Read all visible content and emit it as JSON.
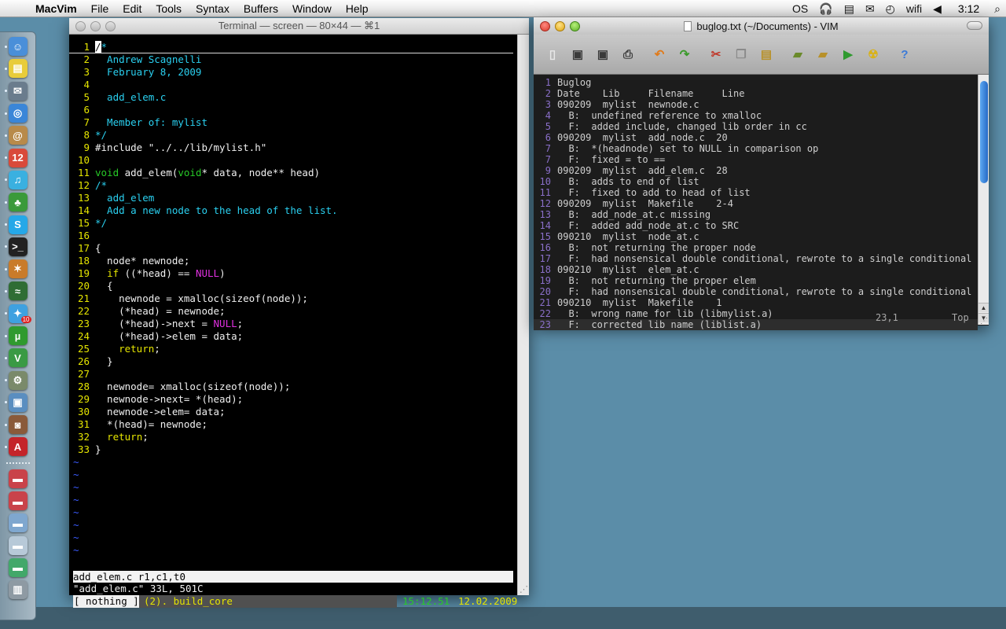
{
  "menubar": {
    "apple": "",
    "app_name": "MacVim",
    "items": [
      "File",
      "Edit",
      "Tools",
      "Syntax",
      "Buffers",
      "Window",
      "Help"
    ],
    "extras": [
      "OS",
      "🎧",
      "▤",
      "✉",
      "◴",
      "wifi",
      "◀"
    ],
    "clock": "3:12",
    "search_icon": "⌕"
  },
  "dock": {
    "items": [
      {
        "name": "finder",
        "glyph": "☺",
        "color": "#4a8fd9",
        "running": true
      },
      {
        "name": "stickies",
        "glyph": "▤",
        "color": "#e8cc3a",
        "running": true
      },
      {
        "name": "mail",
        "glyph": "✉",
        "color": "#6a7c8d",
        "running": true
      },
      {
        "name": "safari",
        "glyph": "◎",
        "color": "#3a86d8",
        "running": true
      },
      {
        "name": "address-book",
        "glyph": "@",
        "color": "#b88a4a",
        "running": true
      },
      {
        "name": "ical",
        "glyph": "12",
        "color": "#d94a3a",
        "running": true
      },
      {
        "name": "itunes",
        "glyph": "♫",
        "color": "#3ab0e0",
        "running": true
      },
      {
        "name": "adium",
        "glyph": "♣",
        "color": "#3a9a3a",
        "running": true
      },
      {
        "name": "skype",
        "glyph": "S",
        "color": "#25a8e8",
        "running": true
      },
      {
        "name": "terminal",
        "glyph": ">_",
        "color": "#222222",
        "running": true
      },
      {
        "name": "growl",
        "glyph": "✶",
        "color": "#c97b2a",
        "running": true
      },
      {
        "name": "activity-monitor",
        "glyph": "≈",
        "color": "#2f6d34",
        "running": true
      },
      {
        "name": "twitter",
        "glyph": "✦",
        "color": "#3fa1e0",
        "running": true,
        "badge": "10"
      },
      {
        "name": "utorrent",
        "glyph": "µ",
        "color": "#2f9a2f",
        "running": true
      },
      {
        "name": "macvim",
        "glyph": "V",
        "color": "#3a9a44",
        "running": true
      },
      {
        "name": "system-prefs",
        "glyph": "⚙",
        "color": "#7a8a6a",
        "running": true
      },
      {
        "name": "preview",
        "glyph": "▣",
        "color": "#5a8ec0",
        "running": true
      },
      {
        "name": "photo-booth",
        "glyph": "◙",
        "color": "#8a5a3a",
        "running": true
      },
      {
        "name": "adobe",
        "glyph": "A",
        "color": "#c4242a",
        "running": true
      }
    ],
    "stacks": [
      {
        "name": "downloads-folder",
        "glyph": "▬",
        "color": "#c9434a"
      },
      {
        "name": "applications-folder",
        "glyph": "▬",
        "color": "#c9434a"
      },
      {
        "name": "documents-folder",
        "glyph": "▬",
        "color": "#7fa7cf"
      },
      {
        "name": "pictures-folder",
        "glyph": "▬",
        "color": "#b7c9d8"
      },
      {
        "name": "music-folder",
        "glyph": "▬",
        "color": "#42a86a"
      },
      {
        "name": "trash",
        "glyph": "▥",
        "color": "#8e9aa3"
      }
    ]
  },
  "terminal": {
    "title": "Terminal — screen — 80×44 — ⌘1",
    "lines": [
      {
        "n": "1",
        "parts": [
          [
            "cursor",
            "/"
          ],
          [
            "c-cm",
            "*"
          ]
        ]
      },
      {
        "n": "2",
        "parts": [
          [
            "c-cm",
            "  Andrew Scagnelli"
          ]
        ]
      },
      {
        "n": "3",
        "parts": [
          [
            "c-cm",
            "  February 8, 2009"
          ]
        ]
      },
      {
        "n": "4",
        "parts": [
          [
            "",
            ""
          ]
        ]
      },
      {
        "n": "5",
        "parts": [
          [
            "c-cm",
            "  add_elem.c"
          ]
        ]
      },
      {
        "n": "6",
        "parts": [
          [
            "",
            ""
          ]
        ]
      },
      {
        "n": "7",
        "parts": [
          [
            "c-cm",
            "  Member of: mylist"
          ]
        ]
      },
      {
        "n": "8",
        "parts": [
          [
            "c-cm",
            "*/"
          ]
        ]
      },
      {
        "n": "9",
        "parts": [
          [
            "c-pp",
            "#include \"../../lib/mylist.h\""
          ]
        ]
      },
      {
        "n": "10",
        "parts": [
          [
            "",
            ""
          ]
        ]
      },
      {
        "n": "11",
        "parts": [
          [
            "c-ty",
            "void"
          ],
          [
            "",
            " add_elem("
          ],
          [
            "c-ty",
            "void"
          ],
          [
            "",
            "* data, node** head)"
          ]
        ]
      },
      {
        "n": "12",
        "parts": [
          [
            "c-cm",
            "/*"
          ]
        ]
      },
      {
        "n": "13",
        "parts": [
          [
            "c-cm",
            "  add_elem"
          ]
        ]
      },
      {
        "n": "14",
        "parts": [
          [
            "c-cm",
            "  Add a new node to the head of the list."
          ]
        ]
      },
      {
        "n": "15",
        "parts": [
          [
            "c-cm",
            "*/"
          ]
        ]
      },
      {
        "n": "16",
        "parts": [
          [
            "",
            ""
          ]
        ]
      },
      {
        "n": "17",
        "parts": [
          [
            "",
            "{"
          ]
        ]
      },
      {
        "n": "18",
        "parts": [
          [
            "",
            "  node* newnode;"
          ]
        ]
      },
      {
        "n": "19",
        "parts": [
          [
            "",
            "  "
          ],
          [
            "c-kw",
            "if"
          ],
          [
            "",
            " ((*head) == "
          ],
          [
            "c-nl",
            "NULL"
          ],
          [
            "",
            ")"
          ]
        ]
      },
      {
        "n": "20",
        "parts": [
          [
            "",
            "  {"
          ]
        ]
      },
      {
        "n": "21",
        "parts": [
          [
            "",
            "    newnode = xmalloc(sizeof(node));"
          ]
        ]
      },
      {
        "n": "22",
        "parts": [
          [
            "",
            "    (*head) = newnode;"
          ]
        ]
      },
      {
        "n": "23",
        "parts": [
          [
            "",
            "    (*head)->next = "
          ],
          [
            "c-nl",
            "NULL"
          ],
          [
            "",
            ";"
          ]
        ]
      },
      {
        "n": "24",
        "parts": [
          [
            "",
            "    (*head)->elem = data;"
          ]
        ]
      },
      {
        "n": "25",
        "parts": [
          [
            "",
            "    "
          ],
          [
            "c-kw",
            "return"
          ],
          [
            "",
            ";"
          ]
        ]
      },
      {
        "n": "26",
        "parts": [
          [
            "",
            "  }"
          ]
        ]
      },
      {
        "n": "27",
        "parts": [
          [
            "",
            ""
          ]
        ]
      },
      {
        "n": "28",
        "parts": [
          [
            "",
            "  newnode= xmalloc(sizeof(node));"
          ]
        ]
      },
      {
        "n": "29",
        "parts": [
          [
            "",
            "  newnode->next= *(head);"
          ]
        ]
      },
      {
        "n": "30",
        "parts": [
          [
            "",
            "  newnode->elem= data;"
          ]
        ]
      },
      {
        "n": "31",
        "parts": [
          [
            "",
            "  *(head)= newnode;"
          ]
        ]
      },
      {
        "n": "32",
        "parts": [
          [
            "",
            "  "
          ],
          [
            "c-kw",
            "return"
          ],
          [
            "",
            ";"
          ]
        ]
      },
      {
        "n": "33",
        "parts": [
          [
            "",
            "}"
          ]
        ]
      }
    ],
    "tilde": "~",
    "status_line": "add_elem.c r1,c1,t0",
    "message_line": "\"add_elem.c\" 33L, 501C",
    "screen_window": "[ nothing ]",
    "screen_core": "(2). build_core",
    "screen_time": "15:12.51",
    "screen_date": "12.02.2009",
    "resize_glyph": "⋰"
  },
  "vim": {
    "title": "buglog.txt (~/Documents) - VIM",
    "toolbar": [
      {
        "name": "open-icon",
        "glyph": "▯",
        "color": "#e8e8e8"
      },
      {
        "name": "save-icon",
        "glyph": "▣",
        "color": "#3a3a3a"
      },
      {
        "name": "save-all-icon",
        "glyph": "▣",
        "color": "#3a3a3a"
      },
      {
        "name": "print-icon",
        "glyph": "⎙",
        "color": "#3a3a3a"
      },
      {
        "name": "gap"
      },
      {
        "name": "undo-icon",
        "glyph": "↶",
        "color": "#e07a1a"
      },
      {
        "name": "redo-icon",
        "glyph": "↷",
        "color": "#3a9a2a"
      },
      {
        "name": "gap"
      },
      {
        "name": "cut-icon",
        "glyph": "✂",
        "color": "#c0392b"
      },
      {
        "name": "copy-icon",
        "glyph": "❐",
        "color": "#8a8a8a"
      },
      {
        "name": "paste-icon",
        "glyph": "▤",
        "color": "#b8912a"
      },
      {
        "name": "gap"
      },
      {
        "name": "load-session-icon",
        "glyph": "▰",
        "color": "#6a8a2a"
      },
      {
        "name": "save-session-icon",
        "glyph": "▰",
        "color": "#b8912a"
      },
      {
        "name": "run-script-icon",
        "glyph": "▶",
        "color": "#2f9a2f"
      },
      {
        "name": "make-icon",
        "glyph": "☢",
        "color": "#d8b21a"
      },
      {
        "name": "gap"
      },
      {
        "name": "help-icon",
        "glyph": "?",
        "color": "#3a7ad8"
      }
    ],
    "lines": [
      {
        "n": "1",
        "text": "Buglog"
      },
      {
        "n": "2",
        "text": "Date    Lib     Filename     Line"
      },
      {
        "n": "3",
        "text": "090209  mylist  newnode.c"
      },
      {
        "n": "4",
        "text": "  B:  undefined reference to xmalloc"
      },
      {
        "n": "5",
        "text": "  F:  added include, changed lib order in cc"
      },
      {
        "n": "6",
        "text": "090209  mylist  add_node.c  20"
      },
      {
        "n": "7",
        "text": "  B:  *(headnode) set to NULL in comparison op"
      },
      {
        "n": "7",
        "text": "  F:  fixed = to =="
      },
      {
        "n": "9",
        "text": "090209  mylist  add_elem.c  28"
      },
      {
        "n": "10",
        "text": "  B:  adds to end of list"
      },
      {
        "n": "11",
        "text": "  F:  fixed to add to head of list"
      },
      {
        "n": "12",
        "text": "090209  mylist  Makefile    2-4"
      },
      {
        "n": "13",
        "text": "  B:  add_node_at.c missing"
      },
      {
        "n": "14",
        "text": "  F:  added add_node_at.c to SRC"
      },
      {
        "n": "15",
        "text": "090210  mylist  node_at.c"
      },
      {
        "n": "16",
        "text": "  B:  not returning the proper node"
      },
      {
        "n": "17",
        "text": "  F:  had nonsensical double conditional, rewrote to a single conditional"
      },
      {
        "n": "18",
        "text": "090210  mylist  elem_at.c"
      },
      {
        "n": "19",
        "text": "  B:  not returning the proper elem"
      },
      {
        "n": "20",
        "text": "  F:  had nonsensical double conditional, rewrote to a single conditional"
      },
      {
        "n": "21",
        "text": "090210  mylist  Makefile    1"
      },
      {
        "n": "22",
        "text": "  B:  wrong name for lib (libmylist.a)"
      },
      {
        "n": "23",
        "text": "  F:  corrected lib name (liblist.a)",
        "current": true
      }
    ],
    "ruler_position": "23,1",
    "ruler_scroll": "Top",
    "scroll_up": "▲",
    "scroll_down": "▼",
    "resize_glyph": "⋰"
  }
}
